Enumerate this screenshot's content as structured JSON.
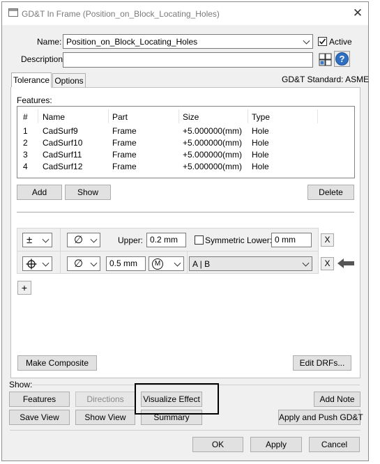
{
  "window": {
    "title": "GD&T In Frame (Position_on_Block_Locating_Holes)"
  },
  "name": {
    "label": "Name:",
    "value": "Position_on_Block_Locating_Holes"
  },
  "active": {
    "label": "Active",
    "checked": true
  },
  "description": {
    "label": "Description:",
    "value": ""
  },
  "tabs": [
    {
      "label": "Tolerance",
      "active": true
    },
    {
      "label": "Options",
      "active": false
    }
  ],
  "standard": "GD&T Standard: ASME",
  "features": {
    "label": "Features:",
    "columns": [
      "#",
      "Name",
      "Part",
      "Size",
      "Type"
    ],
    "rows": [
      {
        "num": "1",
        "name": "CadSurf9",
        "part": "Frame",
        "size": "+5.000000(mm)",
        "type": "Hole"
      },
      {
        "num": "2",
        "name": "CadSurf10",
        "part": "Frame",
        "size": "+5.000000(mm)",
        "type": "Hole"
      },
      {
        "num": "3",
        "name": "CadSurf11",
        "part": "Frame",
        "size": "+5.000000(mm)",
        "type": "Hole"
      },
      {
        "num": "4",
        "name": "CadSurf12",
        "part": "Frame",
        "size": "+5.000000(mm)",
        "type": "Hole"
      }
    ],
    "add_label": "Add",
    "show_label": "Show",
    "delete_label": "Delete"
  },
  "fcf": {
    "row1": {
      "symbol": "±",
      "modifier": "∅",
      "upper_label": "Upper:",
      "upper_value": "0.2 mm",
      "symmetric_label": "Symmetric Lower:",
      "lower_value": "0 mm",
      "remove": "X"
    },
    "row2": {
      "symbol": "⌖",
      "modifier": "∅",
      "tolerance": "0.5 mm",
      "material": "M",
      "datums": "A | B",
      "remove": "X"
    },
    "add_row": "+"
  },
  "make_composite_label": "Make Composite",
  "edit_drfs_label": "Edit DRFs...",
  "show_section": {
    "label": "Show:",
    "features": "Features",
    "directions": "Directions",
    "visualize": "Visualize Effect",
    "add_note": "Add Note",
    "save_view": "Save View",
    "show_view": "Show View",
    "summary": "Summary",
    "apply_push": "Apply and Push GD&T"
  },
  "footer": {
    "ok": "OK",
    "apply": "Apply",
    "cancel": "Cancel"
  },
  "colors": {
    "dialog_bg": "#f0f0f0",
    "button_bg": "#e1e1e1",
    "arrow": "#555555",
    "help_icon": "#2f6fc1"
  }
}
